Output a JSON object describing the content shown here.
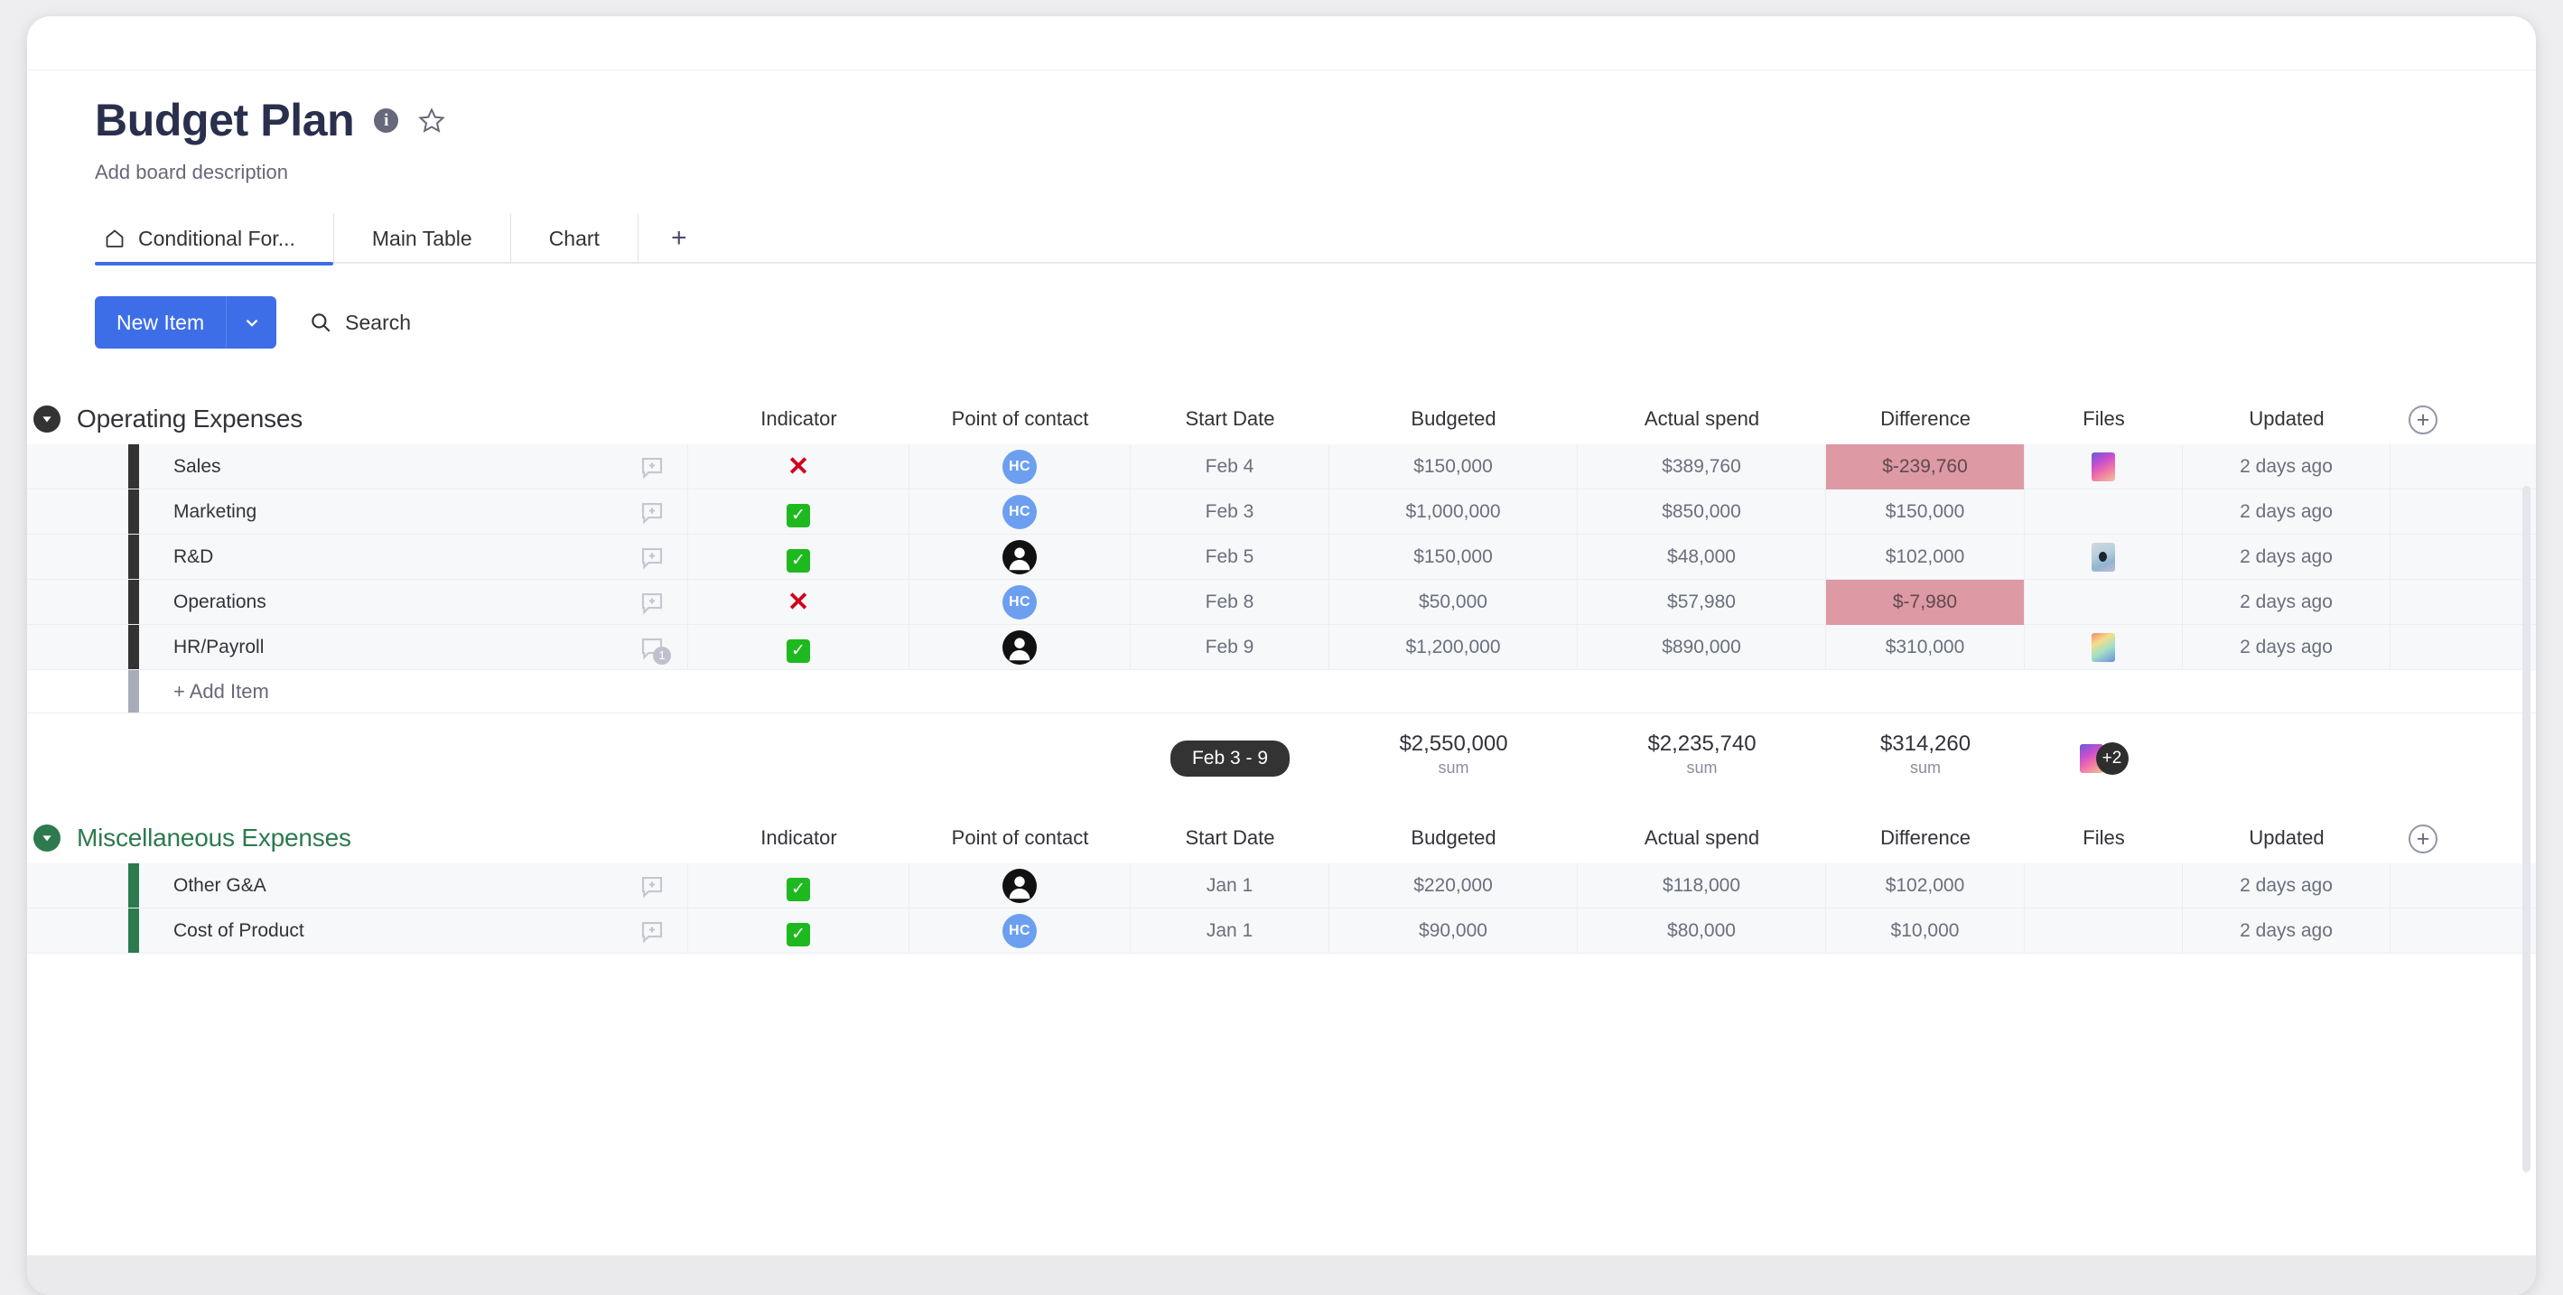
{
  "header": {
    "title": "Budget Plan",
    "description": "Add board description",
    "info_icon": "info-icon",
    "star_icon": "star-outline-icon"
  },
  "tabs": [
    {
      "label": "Conditional For...",
      "icon": "home-icon",
      "active": true
    },
    {
      "label": "Main Table",
      "icon": "",
      "active": false
    },
    {
      "label": "Chart",
      "icon": "",
      "active": false
    },
    {
      "label": "+",
      "icon": "plus-icon",
      "active": false
    }
  ],
  "toolbar": {
    "new_item_label": "New Item",
    "new_item_caret": "chevron-down-icon",
    "search_label": "Search",
    "search_icon": "search-icon"
  },
  "columns": [
    "Indicator",
    "Point of contact",
    "Start Date",
    "Budgeted",
    "Actual spend",
    "Difference",
    "Files",
    "Updated"
  ],
  "add_column_label": "+",
  "add_item_label": "+ Add Item",
  "colors": {
    "accent_blue": "#3d6ee8",
    "group_operating": "#333333",
    "group_misc": "#2d7a4f",
    "negative_cell": "#dd99a4",
    "avatar_blue": "#6c9ff0"
  },
  "groups": [
    {
      "name": "Operating Expenses",
      "color": "#333333",
      "title_color": "#323338",
      "collapsed": false,
      "rows": [
        {
          "name": "Sales",
          "comments": "",
          "indicator": "x",
          "avatar": "HC",
          "start_date": "Feb 4",
          "budgeted": "$150,000",
          "actual": "$389,760",
          "difference": "$-239,760",
          "difference_negative": true,
          "file": "t1",
          "updated": "2 days ago"
        },
        {
          "name": "Marketing",
          "comments": "",
          "indicator": "check",
          "avatar": "HC",
          "start_date": "Feb 3",
          "budgeted": "$1,000,000",
          "actual": "$850,000",
          "difference": "$150,000",
          "difference_negative": false,
          "file": "",
          "updated": "2 days ago"
        },
        {
          "name": "R&D",
          "comments": "",
          "indicator": "check",
          "avatar": "person",
          "start_date": "Feb 5",
          "budgeted": "$150,000",
          "actual": "$48,000",
          "difference": "$102,000",
          "difference_negative": false,
          "file": "t2",
          "updated": "2 days ago"
        },
        {
          "name": "Operations",
          "comments": "",
          "indicator": "x",
          "avatar": "HC",
          "start_date": "Feb 8",
          "budgeted": "$50,000",
          "actual": "$57,980",
          "difference": "$-7,980",
          "difference_negative": true,
          "file": "",
          "updated": "2 days ago"
        },
        {
          "name": "HR/Payroll",
          "comments": "1",
          "indicator": "check",
          "avatar": "person",
          "start_date": "Feb 9",
          "budgeted": "$1,200,000",
          "actual": "$890,000",
          "difference": "$310,000",
          "difference_negative": false,
          "file": "t3",
          "updated": "2 days ago"
        }
      ],
      "summary": {
        "date_range": "Feb 3 - 9",
        "budgeted": "$2,550,000",
        "budgeted_sub": "sum",
        "actual": "$2,235,740",
        "actual_sub": "sum",
        "difference": "$314,260",
        "difference_sub": "sum",
        "files_badge": "+2"
      }
    },
    {
      "name": "Miscellaneous Expenses",
      "color": "#2d7a4f",
      "title_color": "#2d7a4f",
      "collapsed": false,
      "rows": [
        {
          "name": "Other G&A",
          "comments": "",
          "indicator": "check",
          "avatar": "person",
          "start_date": "Jan 1",
          "budgeted": "$220,000",
          "actual": "$118,000",
          "difference": "$102,000",
          "difference_negative": false,
          "file": "",
          "updated": "2 days ago"
        },
        {
          "name": "Cost of Product",
          "comments": "",
          "indicator": "check",
          "avatar": "HC",
          "start_date": "Jan 1",
          "budgeted": "$90,000",
          "actual": "$80,000",
          "difference": "$10,000",
          "difference_negative": false,
          "file": "",
          "updated": "2 days ago"
        }
      ],
      "summary": null
    }
  ]
}
